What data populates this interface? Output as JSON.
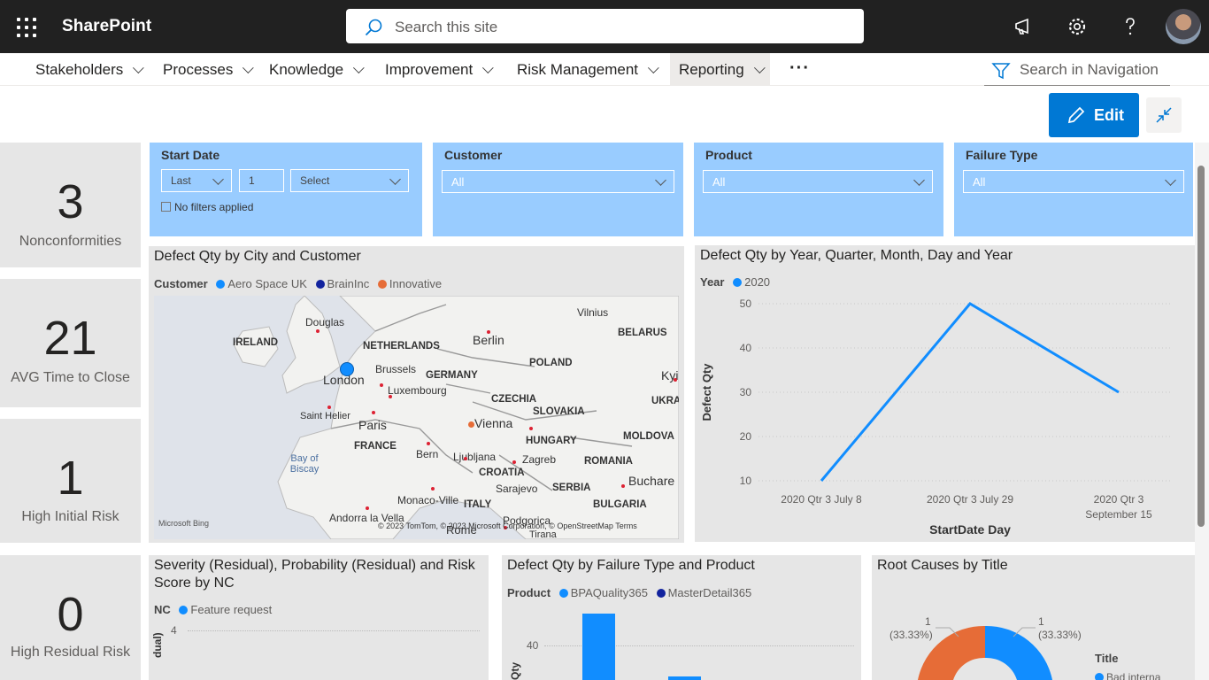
{
  "topbar": {
    "app_name": "SharePoint",
    "search_placeholder": "Search this site",
    "icons": [
      "app-launcher-icon",
      "search-icon",
      "megaphone-icon",
      "gear-icon",
      "help-icon",
      "avatar"
    ]
  },
  "nav": {
    "items": [
      "Stakeholders",
      "Processes",
      "Knowledge",
      "Improvement",
      "Risk Management",
      "Reporting"
    ],
    "active": "Reporting",
    "more": "···",
    "search_placeholder": "Search in Navigation"
  },
  "toolbar": {
    "edit_label": "Edit"
  },
  "kpis": [
    {
      "value": "3",
      "label": "Nonconformities"
    },
    {
      "value": "21",
      "label": "AVG Time to Close"
    },
    {
      "value": "1",
      "label": "High Initial Risk"
    },
    {
      "value": "0",
      "label": "High Residual Risk"
    }
  ],
  "slicers": {
    "start_date": {
      "title": "Start Date",
      "mode": "Last",
      "count": "1",
      "unit": "Select",
      "status": "No filters applied"
    },
    "customer": {
      "title": "Customer",
      "value": "All"
    },
    "product": {
      "title": "Product",
      "value": "All"
    },
    "failure_type": {
      "title": "Failure Type",
      "value": "All"
    }
  },
  "map_visual": {
    "title": "Defect Qty by City and Customer",
    "legend_title": "Customer",
    "legend": [
      {
        "name": "Aero Space UK",
        "color": "#118dff"
      },
      {
        "name": "BrainInc",
        "color": "#12239e"
      },
      {
        "name": "Innovative",
        "color": "#e66c37"
      }
    ],
    "labels": {
      "countries": [
        "IRELAND",
        "NETHERLANDS",
        "GERMANY",
        "POLAND",
        "BELARUS",
        "CZECHIA",
        "SLOVAKIA",
        "UKRA",
        "HUNGARY",
        "MOLDOVA",
        "ROMANIA",
        "FRANCE",
        "CROATIA",
        "SERBIA",
        "BULGARIA",
        "ITALY"
      ],
      "cities": [
        "Douglas",
        "Berlin",
        "Vilnius",
        "London",
        "Brussels",
        "Luxembourg",
        "Saint Helier",
        "Paris",
        "Vienna",
        "Kyi",
        "Bern",
        "Ljubljana",
        "Zagreb",
        "Sarajevo",
        "Buchare",
        "Monaco-Ville",
        "Andorra la Vella",
        "Podgorica",
        "Rome",
        "Tirana"
      ],
      "sea": "Bay of Biscay"
    },
    "attribution": "© 2023 TomTom, © 2023 Microsoft Corporation, © OpenStreetMap  Terms",
    "provider": "Microsoft Bing"
  },
  "line_visual": {
    "title": "Defect Qty by Year, Quarter, Month, Day and Year",
    "legend_title": "Year",
    "legend": [
      {
        "name": "2020",
        "color": "#118dff"
      }
    ]
  },
  "chart_data": [
    {
      "type": "line",
      "title": "Defect Qty by Year, Quarter, Month, Day and Year",
      "xlabel": "StartDate Day",
      "ylabel": "Defect Qty",
      "categories": [
        "2020 Qtr 3 July 8",
        "2020 Qtr 3 July 29",
        "2020 Qtr 3 September 15"
      ],
      "series": [
        {
          "name": "2020",
          "values": [
            10,
            50,
            30
          ],
          "color": "#118dff"
        }
      ],
      "yticks": [
        10,
        20,
        30,
        40,
        50
      ],
      "ylim": [
        10,
        50
      ],
      "grid": true,
      "legend_position": "top-left"
    },
    {
      "type": "bar",
      "title": "Defect Qty by Failure Type and Product",
      "legend_title": "Product",
      "series": [
        {
          "name": "BPAQuality365",
          "color": "#118dff"
        },
        {
          "name": "MasterDetail365",
          "color": "#12239e"
        }
      ],
      "yticks": [
        40
      ],
      "ylabel_partial": "Qty"
    },
    {
      "type": "pie",
      "title": "Root Causes by Title",
      "legend_title": "Title",
      "legend_first_item": "Bad interna",
      "data_labels": [
        "1",
        "(33.33%)",
        "1",
        "(33.33%)"
      ],
      "slices": [
        {
          "value": 1,
          "color": "#118dff"
        },
        {
          "value": 1,
          "color": "#e66c37"
        },
        {
          "value": 1,
          "color": "#12239e"
        }
      ]
    }
  ],
  "severity_visual": {
    "title": "Severity (Residual), Probability (Residual) and Risk Score by NC",
    "legend_title": "NC",
    "legend": [
      {
        "name": "Feature request",
        "color": "#118dff"
      }
    ],
    "ytick": "4",
    "ylabel_partial": "dual)"
  },
  "colors": {
    "accent": "#0078d4",
    "slicer_bg": "#99ccff",
    "panel_bg": "#e6e6e6",
    "topbar": "#212121"
  }
}
